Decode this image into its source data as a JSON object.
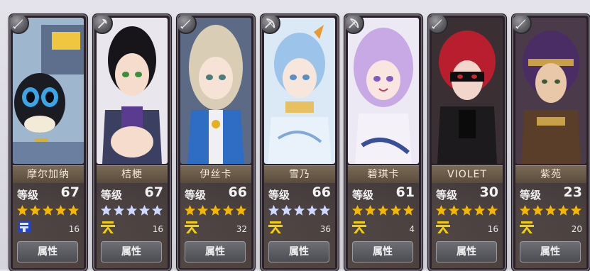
{
  "level_label": "等级",
  "attr_label": "属性",
  "colors": {
    "gold_star": "#f2b705",
    "blue_star": "#cfd8ff",
    "tier_gold": "#f5d000",
    "tier_blue": "#2545c8"
  },
  "cards": [
    {
      "name": "摩尔加纳",
      "level": "67",
      "star_color": "gold",
      "tier_icon": "tier-blue-icon",
      "tier_number": "16",
      "class_icon": "sword-icon"
    },
    {
      "name": "桔梗",
      "level": "67",
      "star_color": "blue",
      "tier_icon": "tier-gold-icon",
      "tier_number": "16",
      "class_icon": "axe-icon"
    },
    {
      "name": "伊丝卡",
      "level": "66",
      "star_color": "gold",
      "tier_icon": "tier-gold-icon",
      "tier_number": "32",
      "class_icon": "sword-icon"
    },
    {
      "name": "雪乃",
      "level": "66",
      "star_color": "blue",
      "tier_icon": "tier-gold-icon",
      "tier_number": "36",
      "class_icon": "bow-icon"
    },
    {
      "name": "碧琪卡",
      "level": "61",
      "star_color": "gold",
      "tier_icon": "tier-gold-icon",
      "tier_number": "4",
      "class_icon": "bow-icon"
    },
    {
      "name": "VIOLET",
      "level": "30",
      "star_color": "gold",
      "tier_icon": "tier-gold-icon",
      "tier_number": "16",
      "class_icon": "sword-icon"
    },
    {
      "name": "紫苑",
      "level": "23",
      "star_color": "gold",
      "tier_icon": "tier-gold-icon",
      "tier_number": "20",
      "class_icon": "sword-icon"
    }
  ]
}
